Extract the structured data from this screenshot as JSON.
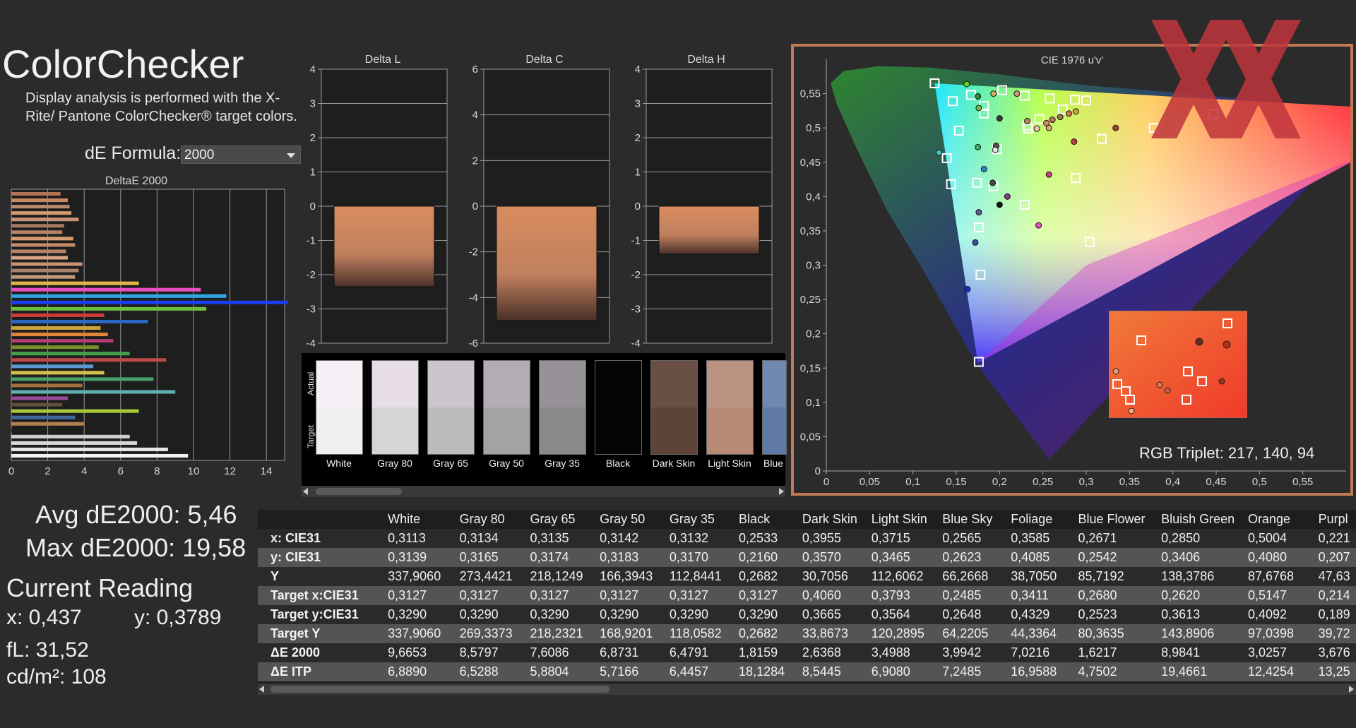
{
  "app": {
    "title": "ColorChecker",
    "description": "Display analysis is performed with the X-Rite/ Pantone ColorChecker® target colors.",
    "de_formula_label": "dE Formula:",
    "de_formula_value": "2000"
  },
  "summary": {
    "avg": "Avg dE2000: 5,46",
    "max": "Max dE2000: 19,58",
    "current_heading": "Current Reading",
    "x": "x: 0,437",
    "y": "y: 0,3789",
    "fl": "fL: 31,52",
    "cd": "cd/m²: 108"
  },
  "swatches": {
    "actual_label": "Actual",
    "target_label": "Target",
    "items": [
      {
        "name": "White",
        "actual": "#f6eff6",
        "target": "#efefef"
      },
      {
        "name": "Gray 80",
        "actual": "#e6dde6",
        "target": "#d5d5d5"
      },
      {
        "name": "Gray 65",
        "actual": "#cdc5cd",
        "target": "#bcbcbc"
      },
      {
        "name": "Gray 50",
        "actual": "#b2adb2",
        "target": "#a4a4a4"
      },
      {
        "name": "Gray 35",
        "actual": "#979297",
        "target": "#8a8a8a"
      },
      {
        "name": "Black",
        "actual": "#050505",
        "target": "#050505"
      },
      {
        "name": "Dark Skin",
        "actual": "#6a4f45",
        "target": "#5e4338"
      },
      {
        "name": "Light Skin",
        "actual": "#bc9383",
        "target": "#b78a75"
      },
      {
        "name": "Blue",
        "actual": "#6f88b0",
        "target": "#5e79a6"
      }
    ]
  },
  "table": {
    "columns": [
      "White",
      "Gray 80",
      "Gray 65",
      "Gray 50",
      "Gray 35",
      "Black",
      "Dark Skin",
      "Light Skin",
      "Blue Sky",
      "Foliage",
      "Blue Flower",
      "Bluish Green",
      "Orange",
      "Purpl"
    ],
    "rows": [
      {
        "label": "x: CIE31",
        "values": [
          "0,3113",
          "0,3134",
          "0,3135",
          "0,3142",
          "0,3132",
          "0,2533",
          "0,3955",
          "0,3715",
          "0,2565",
          "0,3585",
          "0,2671",
          "0,2850",
          "0,5004",
          "0,221"
        ]
      },
      {
        "label": "y: CIE31",
        "values": [
          "0,3139",
          "0,3165",
          "0,3174",
          "0,3183",
          "0,3170",
          "0,2160",
          "0,3570",
          "0,3465",
          "0,2623",
          "0,4085",
          "0,2542",
          "0,3406",
          "0,4080",
          "0,207"
        ]
      },
      {
        "label": "Y",
        "values": [
          "337,9060",
          "273,4421",
          "218,1249",
          "166,3943",
          "112,8441",
          "0,2682",
          "30,7056",
          "112,6062",
          "66,2668",
          "38,7050",
          "85,7192",
          "138,3786",
          "87,6768",
          "47,63"
        ]
      },
      {
        "label": "Target x:CIE31",
        "values": [
          "0,3127",
          "0,3127",
          "0,3127",
          "0,3127",
          "0,3127",
          "0,3127",
          "0,4060",
          "0,3793",
          "0,2485",
          "0,3411",
          "0,2680",
          "0,2620",
          "0,5147",
          "0,214"
        ]
      },
      {
        "label": "Target y:CIE31",
        "values": [
          "0,3290",
          "0,3290",
          "0,3290",
          "0,3290",
          "0,3290",
          "0,3290",
          "0,3665",
          "0,3564",
          "0,2648",
          "0,4329",
          "0,2523",
          "0,3613",
          "0,4092",
          "0,189"
        ]
      },
      {
        "label": "Target Y",
        "values": [
          "337,9060",
          "269,3373",
          "218,2321",
          "168,9201",
          "118,0582",
          "0,2682",
          "33,8673",
          "120,2895",
          "64,2205",
          "44,3364",
          "80,3635",
          "143,8906",
          "97,0398",
          "39,72"
        ]
      },
      {
        "label": "ΔE 2000",
        "values": [
          "9,6653",
          "8,5797",
          "7,6086",
          "6,8731",
          "6,4791",
          "1,8159",
          "2,6368",
          "3,4988",
          "3,9942",
          "7,0216",
          "1,6217",
          "8,9841",
          "3,0257",
          "3,676"
        ]
      },
      {
        "label": "ΔE ITP",
        "values": [
          "6,8890",
          "6,5288",
          "5,8804",
          "5,7166",
          "6,4457",
          "18,1284",
          "8,5445",
          "6,9080",
          "7,2485",
          "16,9588",
          "4,7502",
          "19,4661",
          "12,4254",
          "13,25"
        ]
      }
    ]
  },
  "chart_data": [
    {
      "type": "bar",
      "title": "DeltaE 2000",
      "orientation": "horizontal",
      "xlim": [
        0,
        15
      ],
      "xticks": [
        "0",
        "2",
        "4",
        "6",
        "8",
        "10",
        "12",
        "14"
      ],
      "values": [
        2.7,
        3.1,
        3.2,
        3.3,
        3.7,
        2.9,
        2.8,
        3.4,
        3.5,
        3.0,
        3.1,
        3.9,
        3.7,
        3.5,
        7.0,
        10.4,
        11.8,
        15.2,
        10.7,
        5.1,
        7.5,
        4.9,
        5.3,
        5.6,
        4.8,
        6.5,
        8.5,
        4.5,
        5.1,
        7.8,
        3.9,
        9.0,
        3.1,
        2.8,
        7.0,
        3.5,
        4.0,
        1.8,
        6.5,
        6.9,
        8.6,
        9.7
      ],
      "colors": [
        "#b47356",
        "#c88866",
        "#b98a6e",
        "#d39a6f",
        "#c89274",
        "#a67a62",
        "#b58468",
        "#d79c72",
        "#c58a68",
        "#b98466",
        "#d8a483",
        "#c59273",
        "#a9836f",
        "#c39a7b",
        "#e0b54a",
        "#e54fc0",
        "#30a6e6",
        "#1a3ef0",
        "#6cbf3a",
        "#cc3a3a",
        "#2c67c4",
        "#c9a63a",
        "#e0853a",
        "#b43c78",
        "#7a8f2a",
        "#42a04a",
        "#c04848",
        "#5a9ad0",
        "#d3c24a",
        "#4aa06a",
        "#a56c3c",
        "#5fb0b0",
        "#9a4a9a",
        "#60503c",
        "#a7c83a",
        "#3c6a9a",
        "#b08050",
        "#202020",
        "#cfcfcf",
        "#d9d9d9",
        "#e6e6e6",
        "#f2f2f2"
      ]
    },
    {
      "type": "bar",
      "title": "Delta L",
      "ylim": [
        -4,
        4
      ],
      "yticks": [
        "4",
        "3",
        "2",
        "1",
        "0",
        "-1",
        "-2",
        "-3",
        "-4"
      ],
      "values": [
        -2.35
      ]
    },
    {
      "type": "bar",
      "title": "Delta C",
      "ylim": [
        -6,
        6
      ],
      "yticks": [
        "6",
        "4",
        "2",
        "0",
        "-2",
        "-4",
        "-6"
      ],
      "values": [
        -5.0
      ]
    },
    {
      "type": "bar",
      "title": "Delta H",
      "ylim": [
        -4,
        4
      ],
      "yticks": [
        "4",
        "3",
        "2",
        "1",
        "0",
        "-1",
        "-2",
        "-3",
        "-4"
      ],
      "values": [
        -1.4
      ]
    },
    {
      "type": "scatter",
      "title": "CIE 1976 u'v'",
      "xlim": [
        0,
        0.6
      ],
      "ylim": [
        0,
        0.6
      ],
      "xticks": [
        "0",
        "0,05",
        "0,1",
        "0,15",
        "0,2",
        "0,25",
        "0,3",
        "0,35",
        "0,4",
        "0,45",
        "0,5",
        "0,55"
      ],
      "yticks": [
        "0",
        "0,05",
        "0,1",
        "0,15",
        "0,2",
        "0,25",
        "0,3",
        "0,35",
        "0,4",
        "0,45",
        "0,5",
        "0,55"
      ],
      "target_points": [
        [
          0.125,
          0.565
        ],
        [
          0.146,
          0.539
        ],
        [
          0.167,
          0.548
        ],
        [
          0.182,
          0.532
        ],
        [
          0.203,
          0.555
        ],
        [
          0.229,
          0.547
        ],
        [
          0.258,
          0.543
        ],
        [
          0.287,
          0.541
        ],
        [
          0.3,
          0.54
        ],
        [
          0.182,
          0.521
        ],
        [
          0.273,
          0.527
        ],
        [
          0.246,
          0.513
        ],
        [
          0.232,
          0.503
        ],
        [
          0.233,
          0.499
        ],
        [
          0.318,
          0.484
        ],
        [
          0.378,
          0.5
        ],
        [
          0.447,
          0.52
        ],
        [
          0.153,
          0.496
        ],
        [
          0.139,
          0.456
        ],
        [
          0.197,
          0.469
        ],
        [
          0.144,
          0.418
        ],
        [
          0.174,
          0.42
        ],
        [
          0.193,
          0.415
        ],
        [
          0.229,
          0.388
        ],
        [
          0.288,
          0.427
        ],
        [
          0.176,
          0.355
        ],
        [
          0.304,
          0.334
        ],
        [
          0.178,
          0.286
        ],
        [
          0.176,
          0.159
        ]
      ],
      "measured_points": [
        [
          0.162,
          0.564,
          "#5ee01f"
        ],
        [
          0.193,
          0.55,
          "#d8b05f"
        ],
        [
          0.22,
          0.55,
          "#cf9f7a"
        ],
        [
          0.175,
          0.546,
          "#2f8a2f"
        ],
        [
          0.176,
          0.529,
          "#67c24a"
        ],
        [
          0.2,
          0.514,
          "#3a3a3a"
        ],
        [
          0.232,
          0.51,
          "#c47c5f"
        ],
        [
          0.254,
          0.507,
          "#d88a6b"
        ],
        [
          0.27,
          0.516,
          "#a4714f"
        ],
        [
          0.28,
          0.521,
          "#c97a44"
        ],
        [
          0.288,
          0.524,
          "#d4a04a"
        ],
        [
          0.243,
          0.499,
          "#f0c9a5"
        ],
        [
          0.257,
          0.5,
          "#e3a37f"
        ],
        [
          0.261,
          0.512,
          "#c16d5b"
        ],
        [
          0.286,
          0.48,
          "#bf4040"
        ],
        [
          0.334,
          0.5,
          "#a8402f"
        ],
        [
          0.196,
          0.474,
          "#4f4f4f"
        ],
        [
          0.175,
          0.472,
          "#36b060"
        ],
        [
          0.13,
          0.464,
          "#40c8c0"
        ],
        [
          0.195,
          0.468,
          "#e8e8e8"
        ],
        [
          0.182,
          0.44,
          "#2f80c8"
        ],
        [
          0.192,
          0.42,
          "#4a4a4a"
        ],
        [
          0.257,
          0.432,
          "#c83a8a"
        ],
        [
          0.209,
          0.4,
          "#8a3b8a"
        ],
        [
          0.2,
          0.388,
          "#111111"
        ],
        [
          0.176,
          0.377,
          "#5a5aa0"
        ],
        [
          0.172,
          0.333,
          "#3c4fa8"
        ],
        [
          0.163,
          0.265,
          "#1b2fd0"
        ],
        [
          0.245,
          0.358,
          "#e850c0"
        ]
      ]
    }
  ],
  "cie_inset": {
    "rgb_triplet": "RGB Triplet: 217, 140, 94"
  }
}
